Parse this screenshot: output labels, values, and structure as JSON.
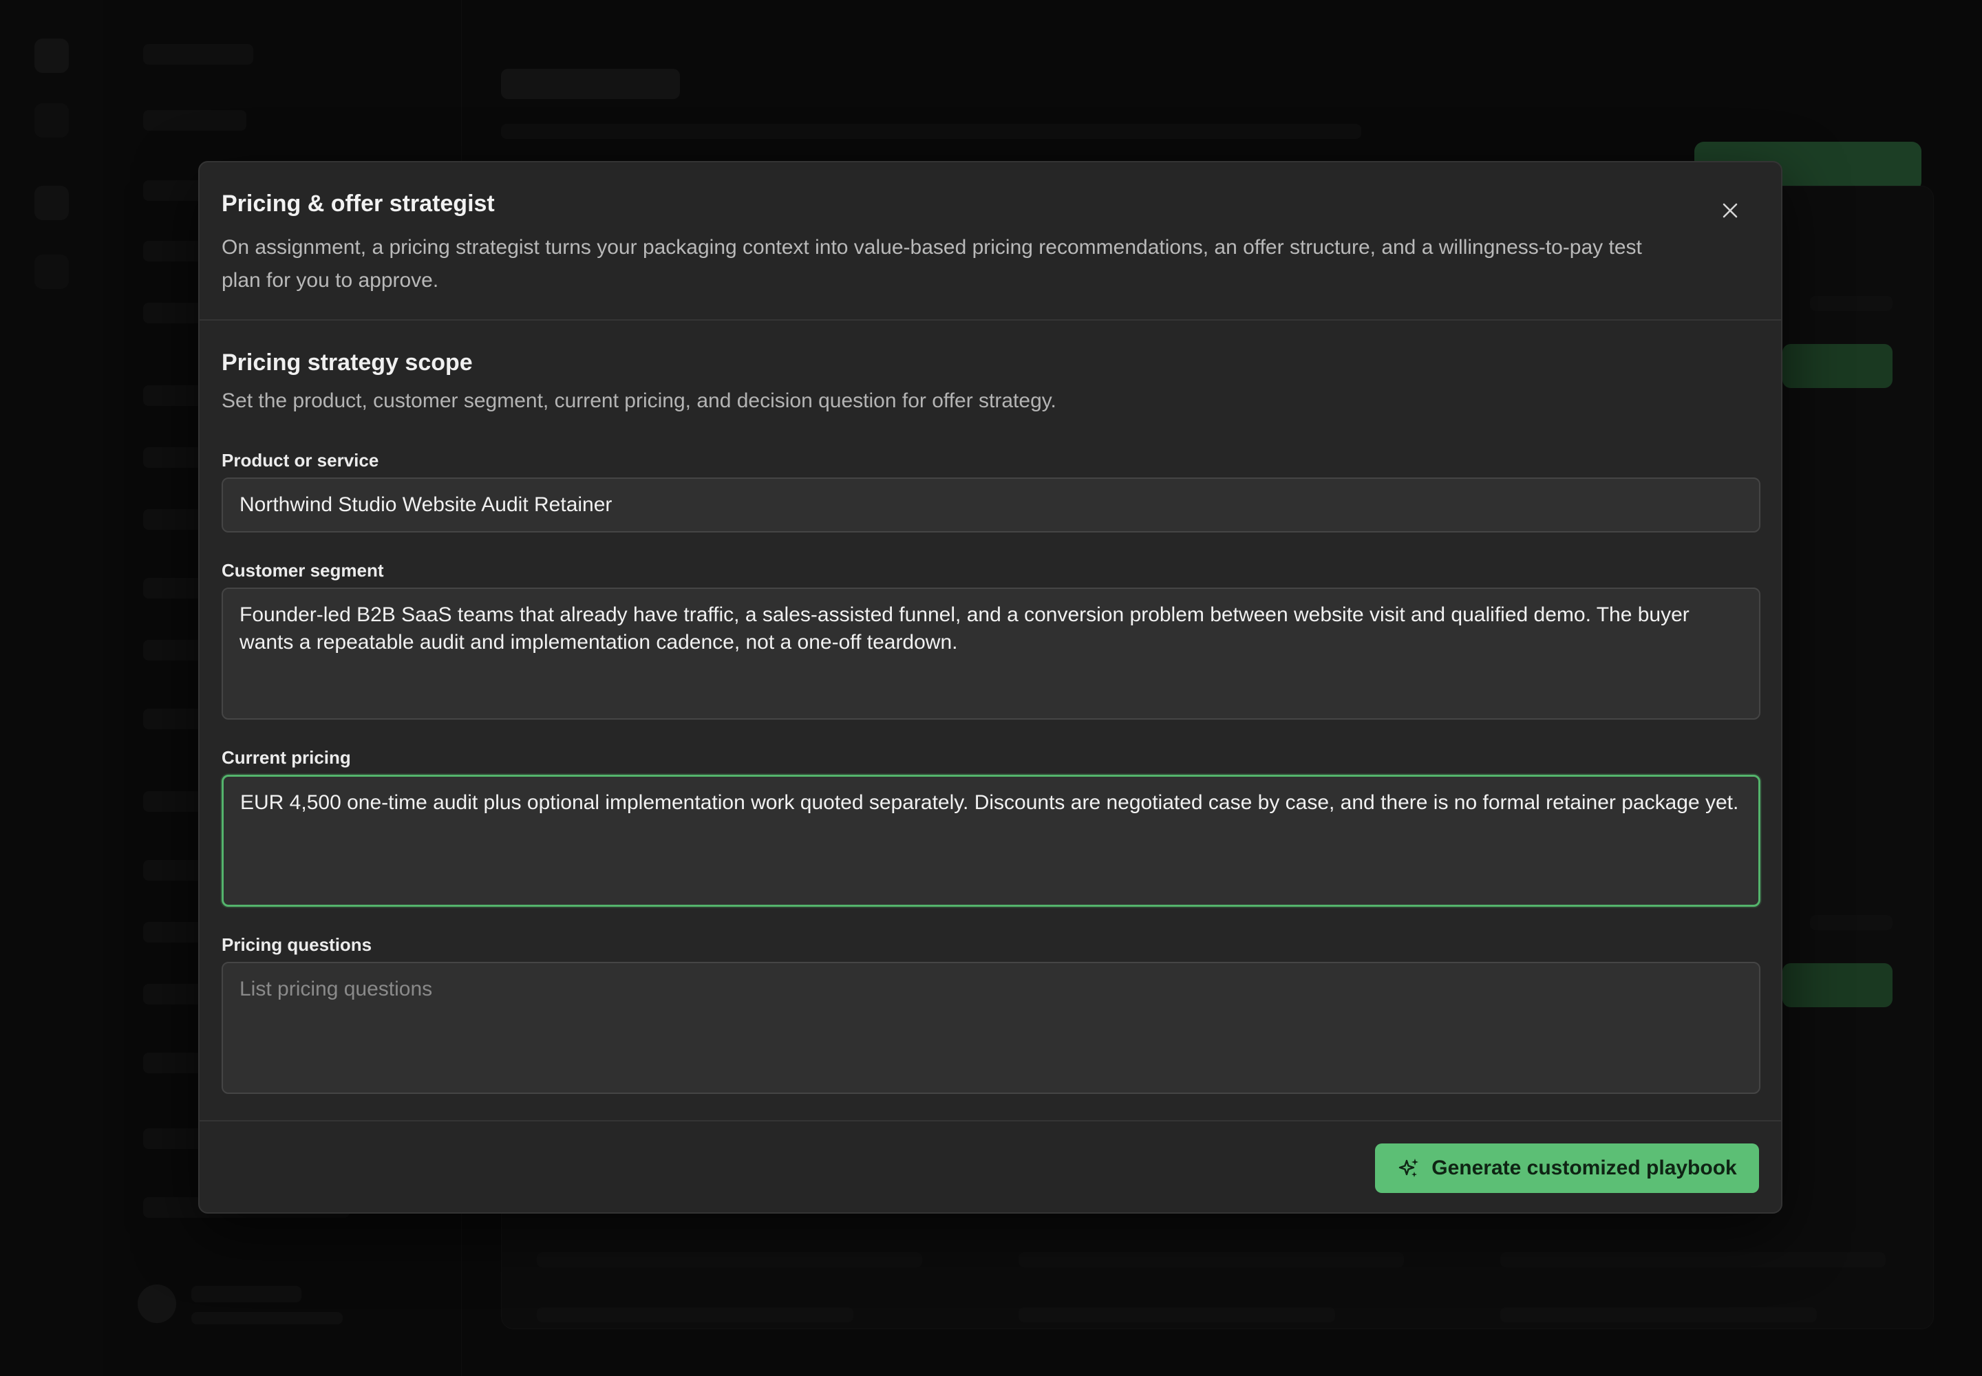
{
  "modal": {
    "title": "Pricing & offer strategist",
    "description": "On assignment, a pricing strategist turns your packaging context into value-based pricing recommendations, an offer structure, and a willingness-to-pay test plan for you to approve.",
    "close_icon": "close-icon"
  },
  "scope": {
    "title": "Pricing strategy scope",
    "description": "Set the product, customer segment, current pricing, and decision question for offer strategy."
  },
  "fields": {
    "product": {
      "label": "Product or service",
      "value": "Northwind Studio Website Audit Retainer"
    },
    "segment": {
      "label": "Customer segment",
      "value": "Founder-led B2B SaaS teams that already have traffic, a sales-assisted funnel, and a conversion problem between website visit and qualified demo. The buyer wants a repeatable audit and implementation cadence, not a one-off teardown."
    },
    "pricing": {
      "label": "Current pricing",
      "value": "EUR 4,500 one-time audit plus optional implementation work quoted separately. Discounts are negotiated case by case, and there is no formal retainer package yet."
    },
    "questions": {
      "label": "Pricing questions",
      "value": "",
      "placeholder": "List pricing questions"
    }
  },
  "footer": {
    "generate_label": "Generate customized playbook",
    "generate_icon": "sparkles-icon"
  },
  "colors": {
    "accent": "#5cbf75",
    "modal_bg": "#262626",
    "focus_border": "#54b46c"
  }
}
